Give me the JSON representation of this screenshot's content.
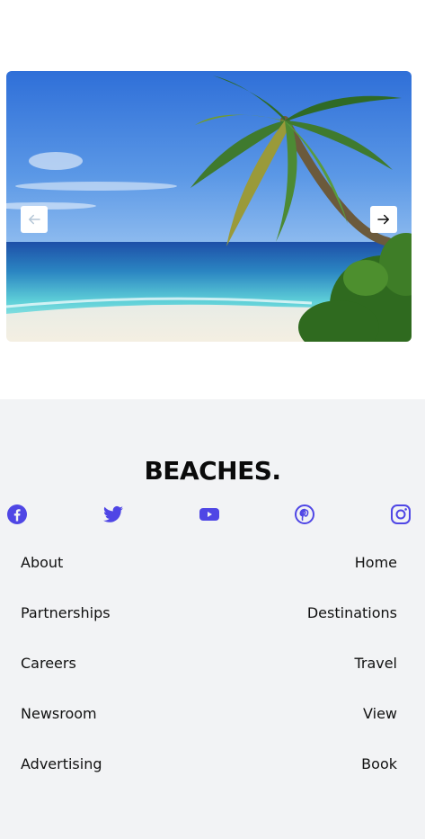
{
  "carousel": {
    "prev_icon": "arrow-left-icon",
    "next_icon": "arrow-right-icon"
  },
  "footer": {
    "brand": "BEACHES.",
    "socials": [
      {
        "icon": "facebook-icon",
        "color": "#4f46e5"
      },
      {
        "icon": "twitter-icon",
        "color": "#4f46e5"
      },
      {
        "icon": "youtube-icon",
        "color": "#4f46e5"
      },
      {
        "icon": "pinterest-icon",
        "color": "#4f46e5"
      },
      {
        "icon": "instagram-icon",
        "color": "#4f46e5"
      }
    ],
    "left_links": [
      "About",
      "Partnerships",
      "Careers",
      "Newsroom",
      "Advertising"
    ],
    "right_links": [
      "Home",
      "Destinations",
      "Travel",
      "View",
      "Book"
    ],
    "background": "#f2f3f5"
  }
}
